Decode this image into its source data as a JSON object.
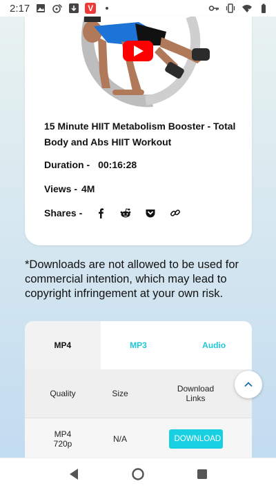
{
  "status_bar": {
    "time": "2:17",
    "notif_icons": [
      "image-icon",
      "weibo-icon",
      "download-icon",
      "vivaldi-icon",
      "dot-icon"
    ],
    "vivaldi_letter": "V",
    "sys_icons": [
      "key-icon",
      "vibrate-icon",
      "wifi-icon",
      "battery-icon"
    ]
  },
  "video": {
    "title": "15 Minute HIIT Metabolism Booster - Total Body and Abs HIIT Workout",
    "duration_label": "Duration -",
    "duration_value": "00:16:28",
    "views_label": "Views -",
    "views_value": "4M",
    "shares_label": "Shares -",
    "share_icons": [
      "facebook-icon",
      "reddit-icon",
      "pocket-icon",
      "link-icon"
    ]
  },
  "disclaimer": "*Downloads are not allowed to be used for commercial intention, which may lead to copyright infringement at your own risk.",
  "download": {
    "tabs": [
      {
        "label": "MP4",
        "active": true
      },
      {
        "label": "MP3",
        "active": false
      },
      {
        "label": "Audio",
        "active": false
      }
    ],
    "headers": {
      "quality": "Quality",
      "size": "Size",
      "links": "Download Links"
    },
    "rows": [
      {
        "quality": "MP4 720p",
        "size": "N/A",
        "button": "DOWNLOAD"
      }
    ]
  },
  "colors": {
    "accent": "#19d0e2",
    "youtube_red": "#ff0000"
  }
}
